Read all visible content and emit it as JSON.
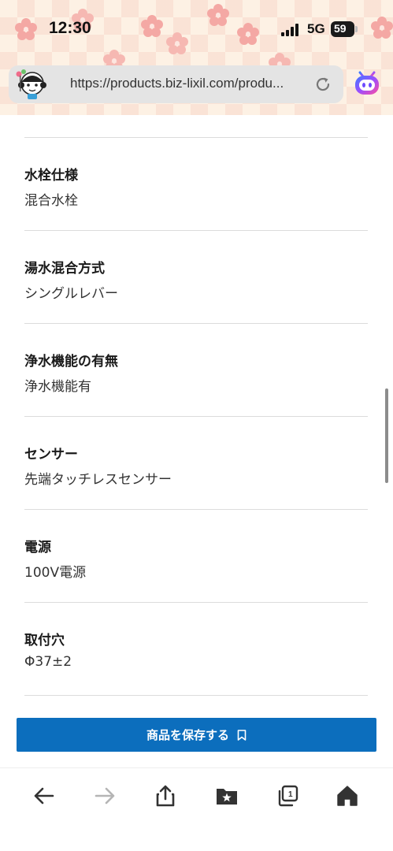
{
  "status_bar": {
    "time": "12:30",
    "network": "5G",
    "battery_level": "59"
  },
  "browser": {
    "url": "https://products.biz-lixil.com/produ..."
  },
  "specs": [
    {
      "label": "水栓仕様",
      "value": "混合水栓"
    },
    {
      "label": "湯水混合方式",
      "value": "シングルレバー"
    },
    {
      "label": "浄水機能の有無",
      "value": "浄水機能有"
    },
    {
      "label": "センサー",
      "value": "先端タッチレスセンサー"
    },
    {
      "label": "電源",
      "value": "100V電源"
    },
    {
      "label": "取付穴",
      "value": "Φ37±2"
    }
  ],
  "save_button": {
    "label": "商品を保存する"
  },
  "toolbar": {
    "tab_count": "1"
  },
  "colors": {
    "accent": "#0c6ebd",
    "status_background": "#fdf1e4"
  },
  "icons": [
    "signal-icon",
    "battery-icon",
    "site-mascot-icon",
    "reload-icon",
    "ai-assistant-icon",
    "bookmark-icon",
    "back-arrow-icon",
    "forward-arrow-icon",
    "share-icon",
    "bookmarks-folder-icon",
    "tabs-icon",
    "home-icon"
  ]
}
